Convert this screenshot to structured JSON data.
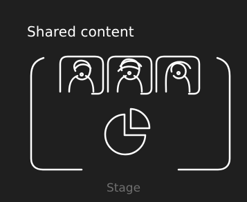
{
  "panel": {
    "title": "Shared content",
    "option_label": "Stage"
  },
  "icons": {
    "frame": "stage-frame-icon",
    "participants": [
      "participant-icon",
      "participant-icon",
      "participant-icon"
    ],
    "content": "pie-chart-icon"
  },
  "colors": {
    "background": "#1f1f1f",
    "foreground": "#ffffff",
    "muted_label": "#6f6f6f"
  }
}
